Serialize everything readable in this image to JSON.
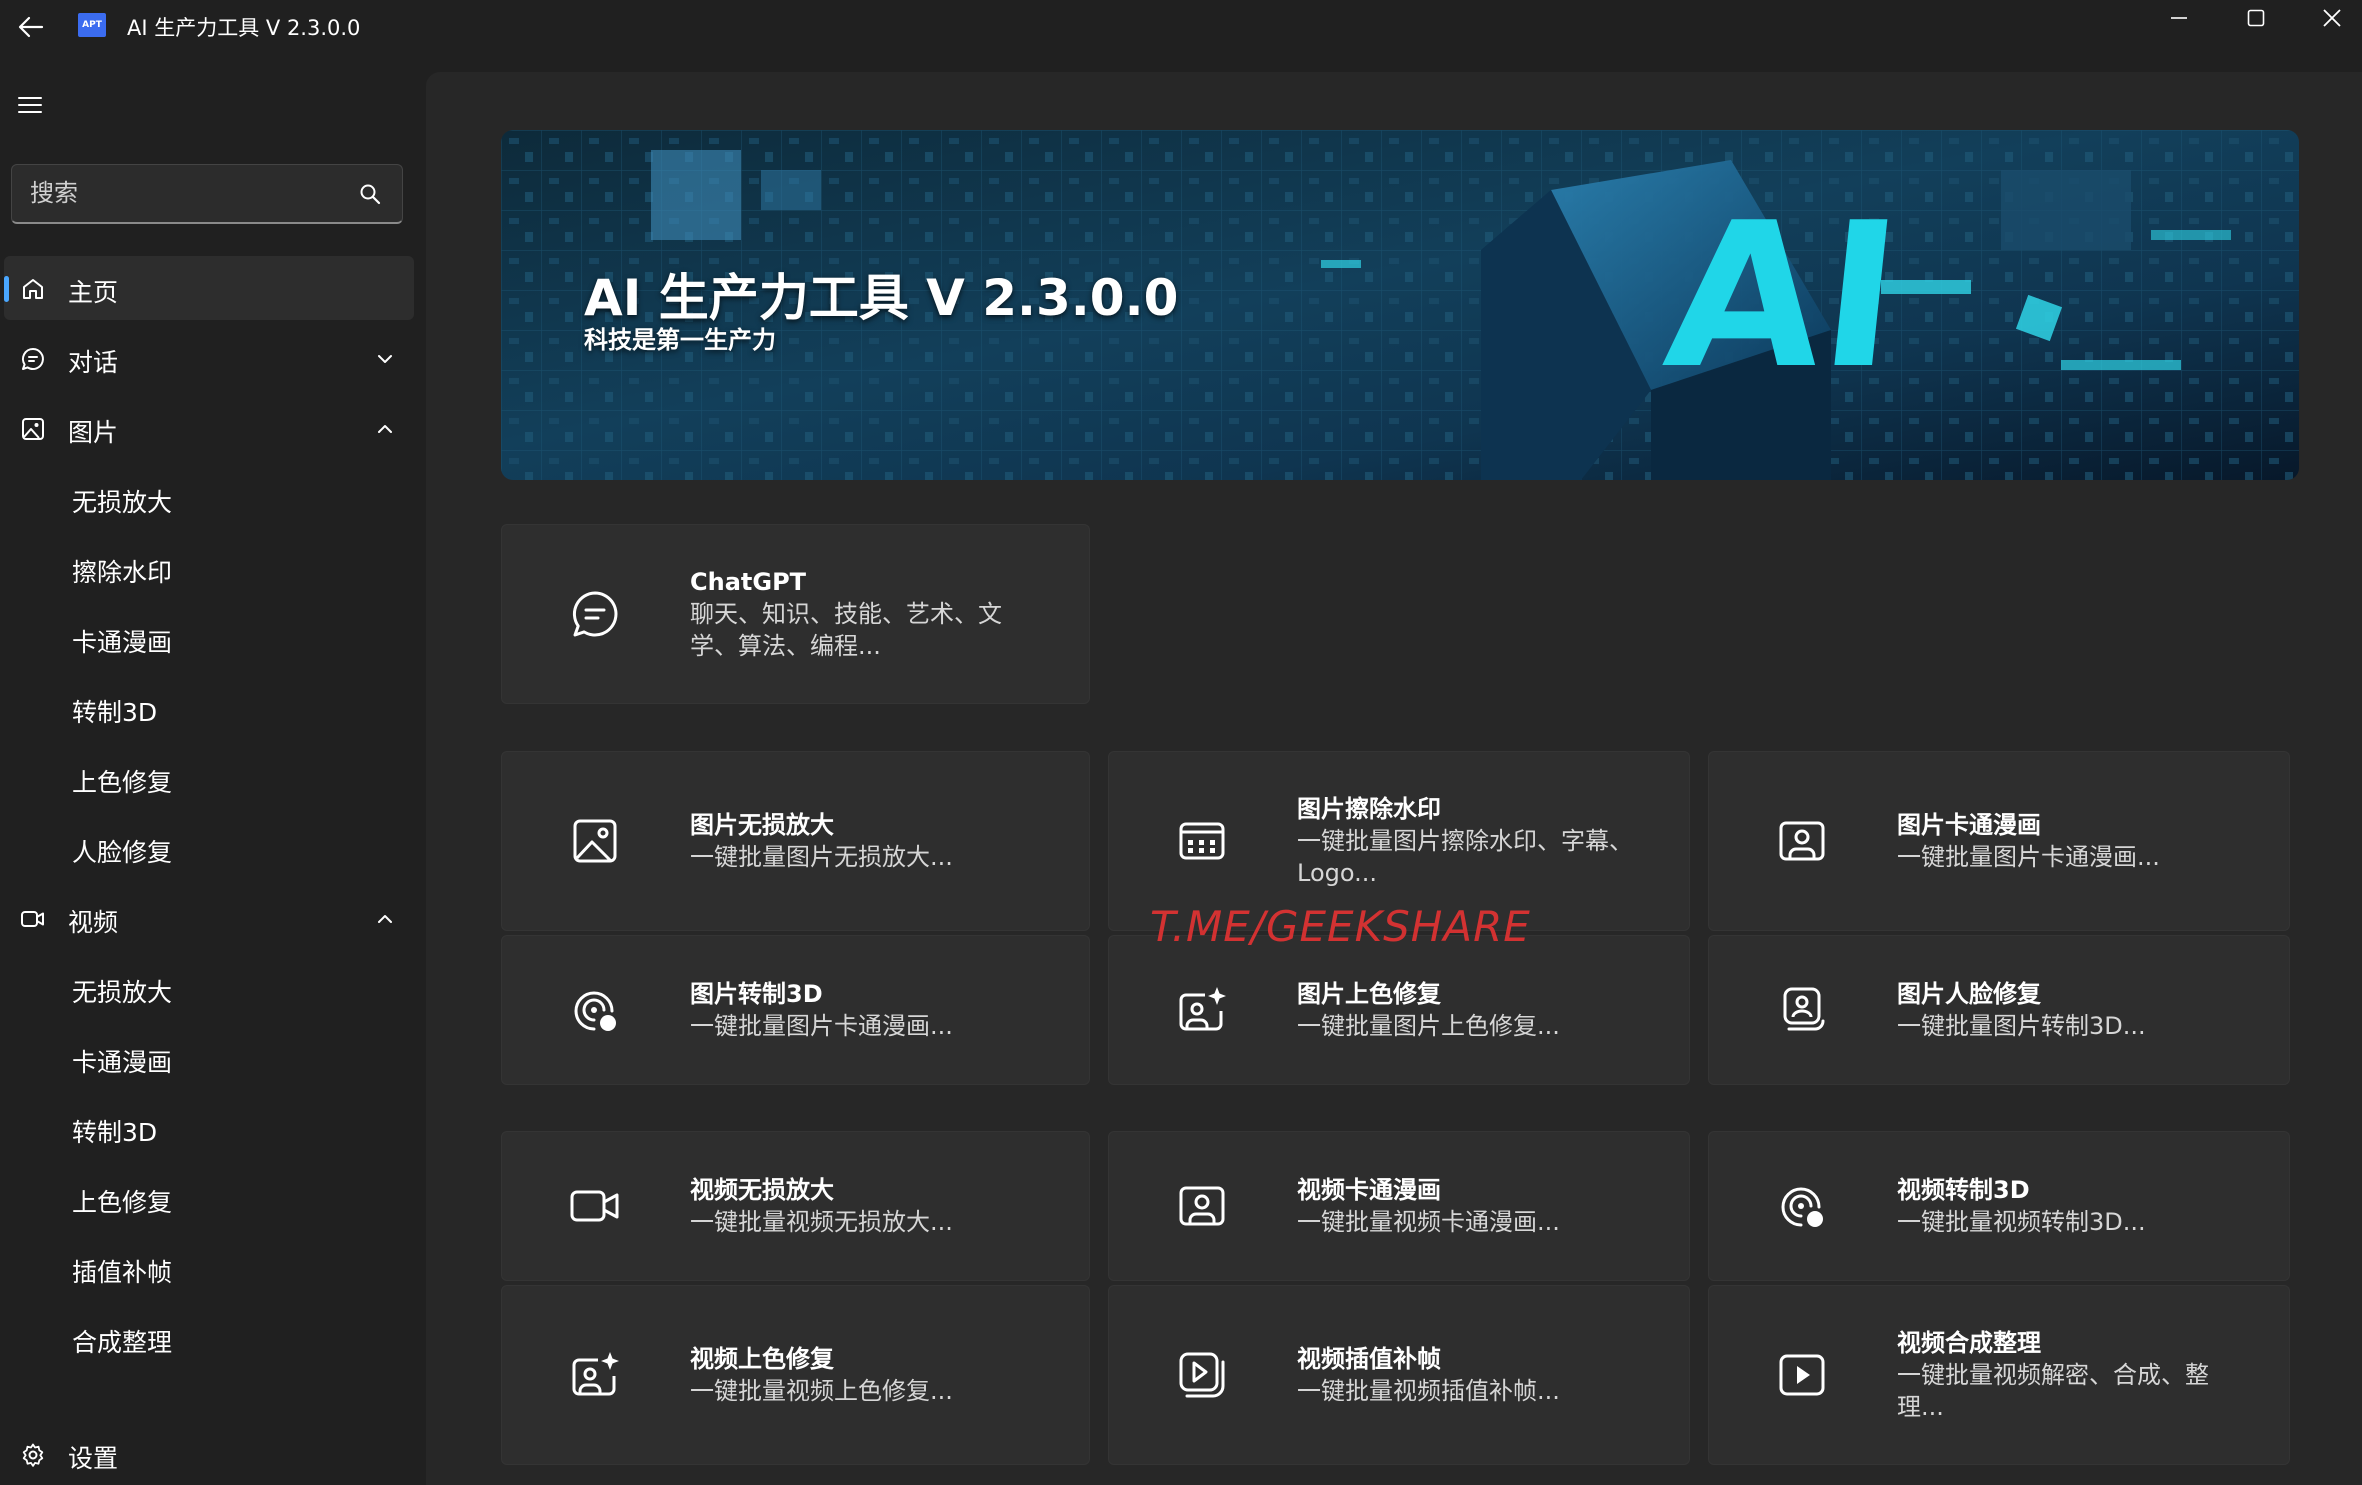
{
  "window": {
    "title": "AI 生产力工具 V 2.3.0.0",
    "logo_text": "APT"
  },
  "sidebar": {
    "search_placeholder": "搜索",
    "home": "主页",
    "chat": "对话",
    "image": "图片",
    "image_items": [
      "无损放大",
      "擦除水印",
      "卡通漫画",
      "转制3D",
      "上色修复",
      "人脸修复"
    ],
    "video": "视频",
    "video_items": [
      "无损放大",
      "卡通漫画",
      "转制3D",
      "上色修复",
      "插值补帧",
      "合成整理"
    ],
    "settings": "设置"
  },
  "banner": {
    "title": "AI 生产力工具 V 2.3.0.0",
    "subtitle": "科技是第一生产力",
    "art_text": "AI"
  },
  "cards": {
    "chatgpt": {
      "title": "ChatGPT",
      "desc": "聊天、知识、技能、艺术、文学、算法、编程...",
      "icon": "chat-icon"
    },
    "image_upscale": {
      "title": "图片无损放大",
      "desc": "一键批量图片无损放大...",
      "icon": "image-icon"
    },
    "image_watermark": {
      "title": "图片擦除水印",
      "desc": "一键批量图片擦除水印、字幕、Logo...",
      "icon": "image-grid-icon"
    },
    "image_cartoon": {
      "title": "图片卡通漫画",
      "desc": "一键批量图片卡通漫画...",
      "icon": "portrait-icon"
    },
    "image_3d": {
      "title": "图片转制3D",
      "desc": "一键批量图片卡通漫画...",
      "icon": "sticker-3d-icon"
    },
    "image_color": {
      "title": "图片上色修复",
      "desc": "一键批量图片上色修复...",
      "icon": "sparkle-portrait-icon"
    },
    "image_face": {
      "title": "图片人脸修复",
      "desc": "一键批量图片转制3D...",
      "icon": "face-stack-icon"
    },
    "video_upscale": {
      "title": "视频无损放大",
      "desc": "一键批量视频无损放大...",
      "icon": "video-camera-icon"
    },
    "video_cartoon": {
      "title": "视频卡通漫画",
      "desc": "一键批量视频卡通漫画...",
      "icon": "portrait-icon"
    },
    "video_3d": {
      "title": "视频转制3D",
      "desc": "一键批量视频转制3D...",
      "icon": "sticker-3d-icon"
    },
    "video_color": {
      "title": "视频上色修复",
      "desc": "一键批量视频上色修复...",
      "icon": "sparkle-portrait-icon"
    },
    "video_interp": {
      "title": "视频插值补帧",
      "desc": "一键批量视频插值补帧...",
      "icon": "video-stack-icon"
    },
    "video_merge": {
      "title": "视频合成整理",
      "desc": "一键批量视频解密、合成、整理...",
      "icon": "play-icon"
    }
  },
  "watermark": "T.ME/GEEKSHARE",
  "colors": {
    "accent": "#4aa7ff",
    "background": "#202020",
    "card": "#2e2e2e"
  }
}
